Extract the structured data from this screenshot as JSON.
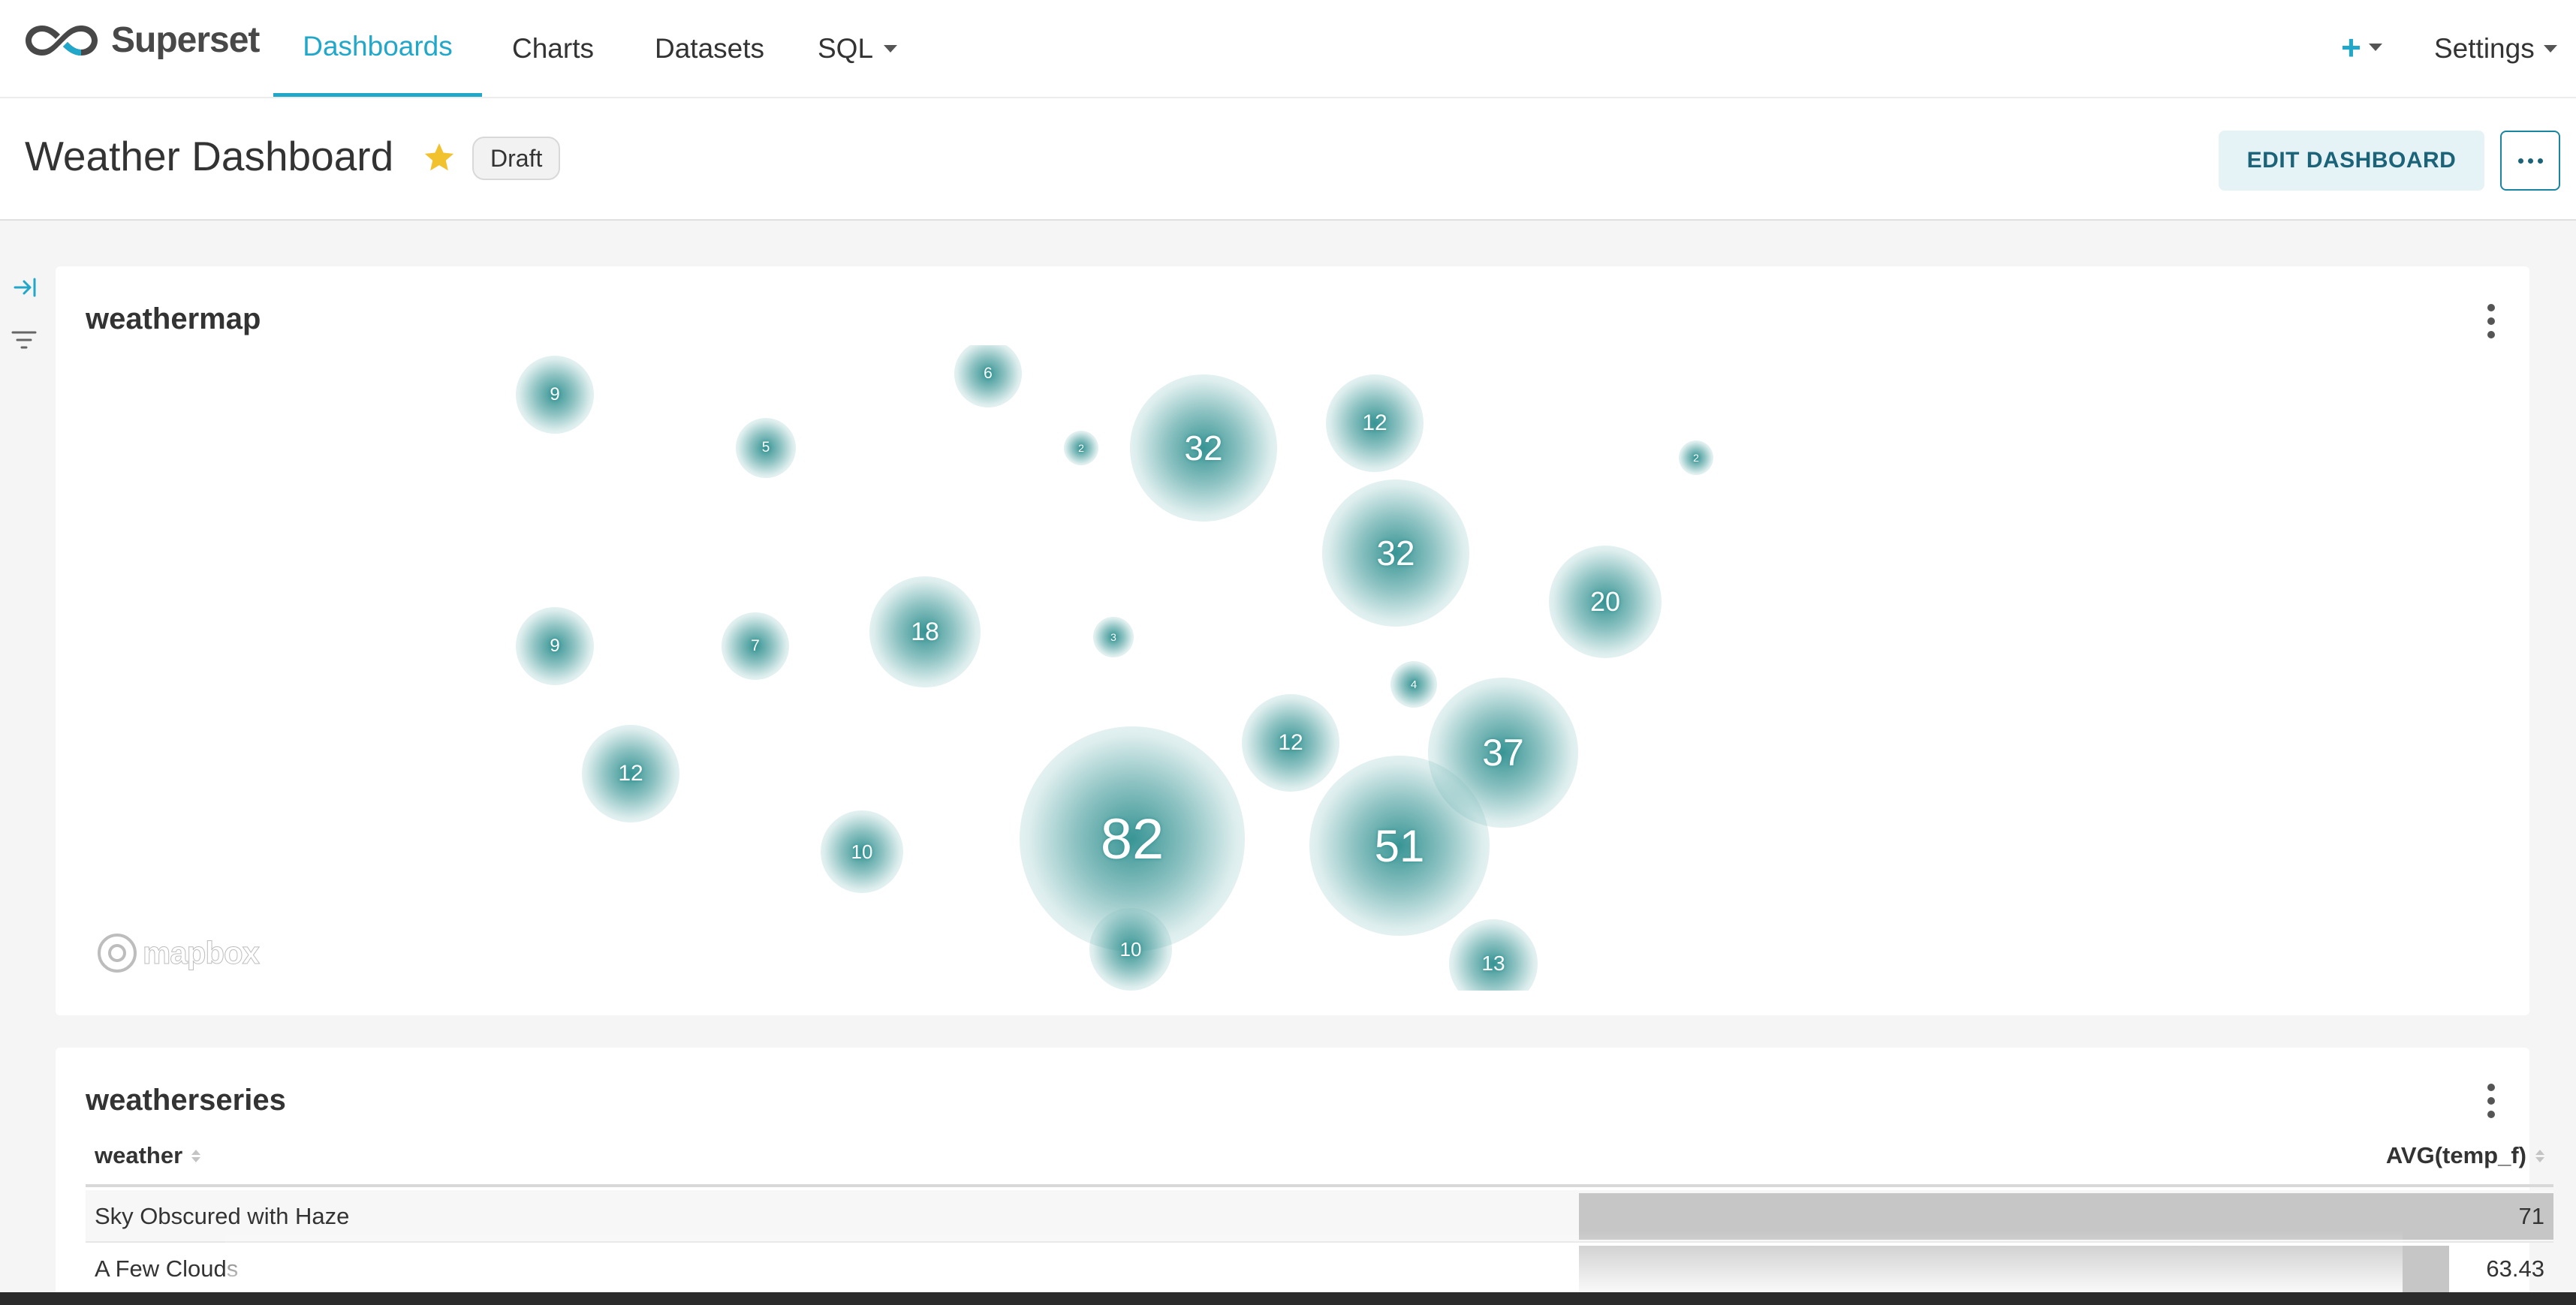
{
  "app": {
    "brand": "Superset",
    "nav": [
      {
        "label": "Dashboards",
        "active": true
      },
      {
        "label": "Charts",
        "active": false
      },
      {
        "label": "Datasets",
        "active": false
      },
      {
        "label": "SQL",
        "active": false,
        "dropdown": true
      }
    ],
    "right": {
      "plus": "+",
      "settings": "Settings"
    }
  },
  "dashboard": {
    "title": "Weather Dashboard",
    "favorite": true,
    "status": "Draft",
    "edit_label": "EDIT DASHBOARD",
    "more_label": "..."
  },
  "weathermap": {
    "title": "weathermap",
    "attribution": "mapbox",
    "cluster_color": "#2e8f8f",
    "clusters": [
      "9",
      "6",
      "5",
      "2",
      "32",
      "12",
      "2",
      "32",
      "20",
      "9",
      "7",
      "18",
      "3",
      "4",
      "12",
      "37",
      "12",
      "10",
      "82",
      "51",
      "10",
      "13"
    ]
  },
  "weatherseries": {
    "title": "weatherseries",
    "columns": [
      "weather",
      "AVG(temp_f)"
    ],
    "rows": [
      {
        "weather": "Sky Obscured with Haze",
        "avg": "71",
        "fraction": 1.0
      },
      {
        "weather": "A Few Clouds",
        "avg": "63.43",
        "fraction": 0.893
      }
    ]
  },
  "colors": {
    "accent": "#20a7c9",
    "star": "#f2c12e",
    "edit_bg": "#e6f3f6",
    "edit_text": "#1a6378"
  }
}
